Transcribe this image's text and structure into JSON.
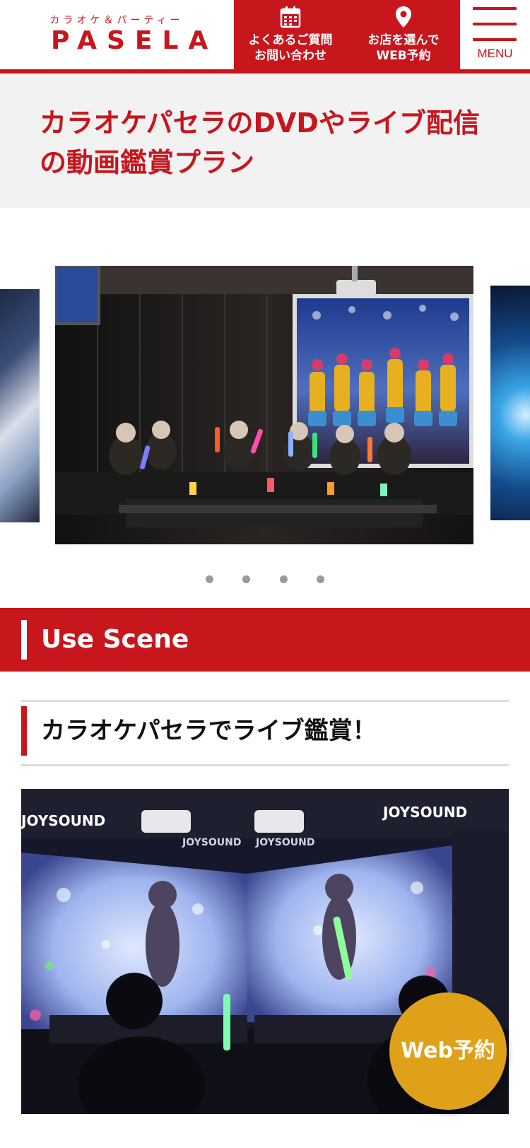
{
  "header": {
    "logo_sub": "カラオケ＆パーティー",
    "logo_main": "PASELA",
    "faq_button": "よくあるご質問\nお問い合わせ",
    "web_button": "お店を選んで\nWEB予約",
    "menu_label": "MENU",
    "faq_icon": "calendar-icon",
    "web_icon": "map-pin-icon"
  },
  "page": {
    "title": "カラオケパセラのDVDやライブ配信の動画鑑賞プラン"
  },
  "carousel": {
    "slide_count": 4,
    "active_index": 0
  },
  "section": {
    "title": "Use Scene",
    "subtitle": "カラオケパセラでライブ鑑賞！"
  },
  "images": {
    "scene_logo_1": "JOYSOUND",
    "scene_logo_2": "JOYSOUND",
    "scene_logo_3": "JOYSOUND",
    "scene_logo_4": "JOYSOUND"
  },
  "floating": {
    "web_reserve_label": "Web予約"
  },
  "colors": {
    "brand_red": "#c8161d",
    "reserve_gold": "#e0a11a",
    "title_band_bg": "#f2f2f2"
  }
}
